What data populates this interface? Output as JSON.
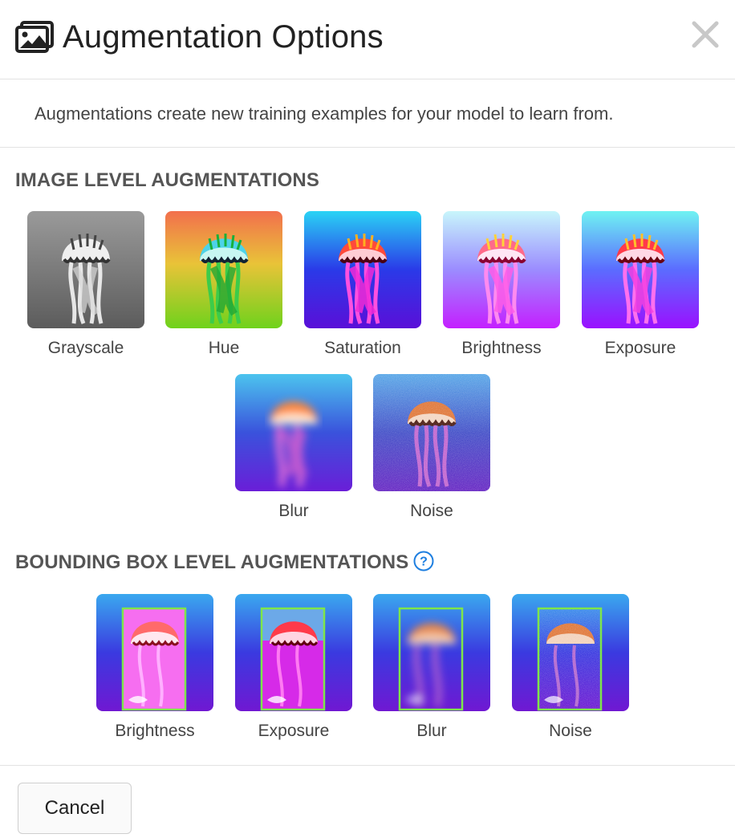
{
  "dialog": {
    "title": "Augmentation Options",
    "title_icon": "images-icon",
    "close_icon": "close-icon",
    "description": "Augmentations create new training examples for your model to learn from."
  },
  "image_level": {
    "title": "IMAGE LEVEL AUGMENTATIONS",
    "items": [
      {
        "label": "Grayscale"
      },
      {
        "label": "Hue"
      },
      {
        "label": "Saturation"
      },
      {
        "label": "Brightness"
      },
      {
        "label": "Exposure"
      },
      {
        "label": "Blur"
      },
      {
        "label": "Noise"
      }
    ]
  },
  "bbox_level": {
    "title": "BOUNDING BOX LEVEL AUGMENTATIONS",
    "help_icon": "help-icon",
    "items": [
      {
        "label": "Brightness"
      },
      {
        "label": "Exposure"
      },
      {
        "label": "Blur"
      },
      {
        "label": "Noise"
      }
    ]
  },
  "footer": {
    "cancel_label": "Cancel"
  },
  "colors": {
    "bbox_outline": "#7ee64a",
    "help_blue": "#1e7fe0"
  }
}
